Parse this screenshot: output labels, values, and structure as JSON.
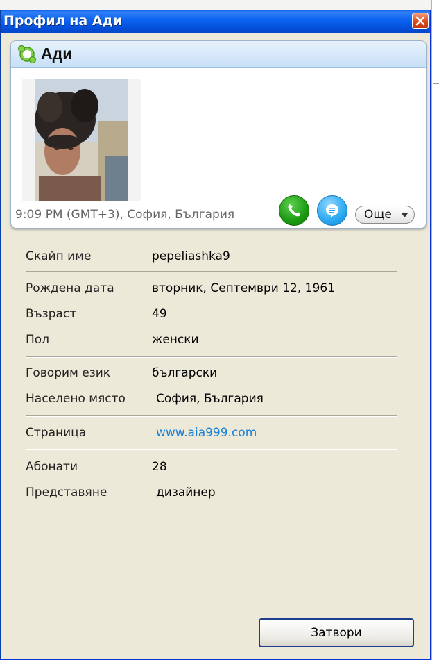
{
  "window": {
    "title": "Профил на Ади"
  },
  "profile": {
    "display_name": "Ади",
    "status_icon": "skype-online-icon",
    "location_time": "9:09 PM (GMT+3), София, България",
    "more_label": "Още"
  },
  "details": {
    "skype_name": {
      "label": "Скайп име",
      "value": "pepeliashka9"
    },
    "birth_date": {
      "label": "Рождена дата",
      "value": "вторник, Септември 12, 1961"
    },
    "age": {
      "label": "Възраст",
      "value": "49"
    },
    "gender": {
      "label": "Пол",
      "value": "женски"
    },
    "language": {
      "label": "Говорим език",
      "value": "български"
    },
    "city": {
      "label": "Населено място",
      "value": "София, България"
    },
    "homepage": {
      "label": "Страница",
      "value": "www.aia999.com"
    },
    "subscribers": {
      "label": "Абонати",
      "value": "28"
    },
    "about": {
      "label": "Представяне",
      "value": "дизайнер"
    }
  },
  "footer": {
    "close_label": "Затвори"
  },
  "colors": {
    "titlebar": "#0b62f0",
    "window_bg": "#ece9d8",
    "link": "#1a7fd6",
    "call_green": "#1b9a12",
    "chat_blue": "#2aa9f0",
    "close_red": "#d9491c"
  }
}
